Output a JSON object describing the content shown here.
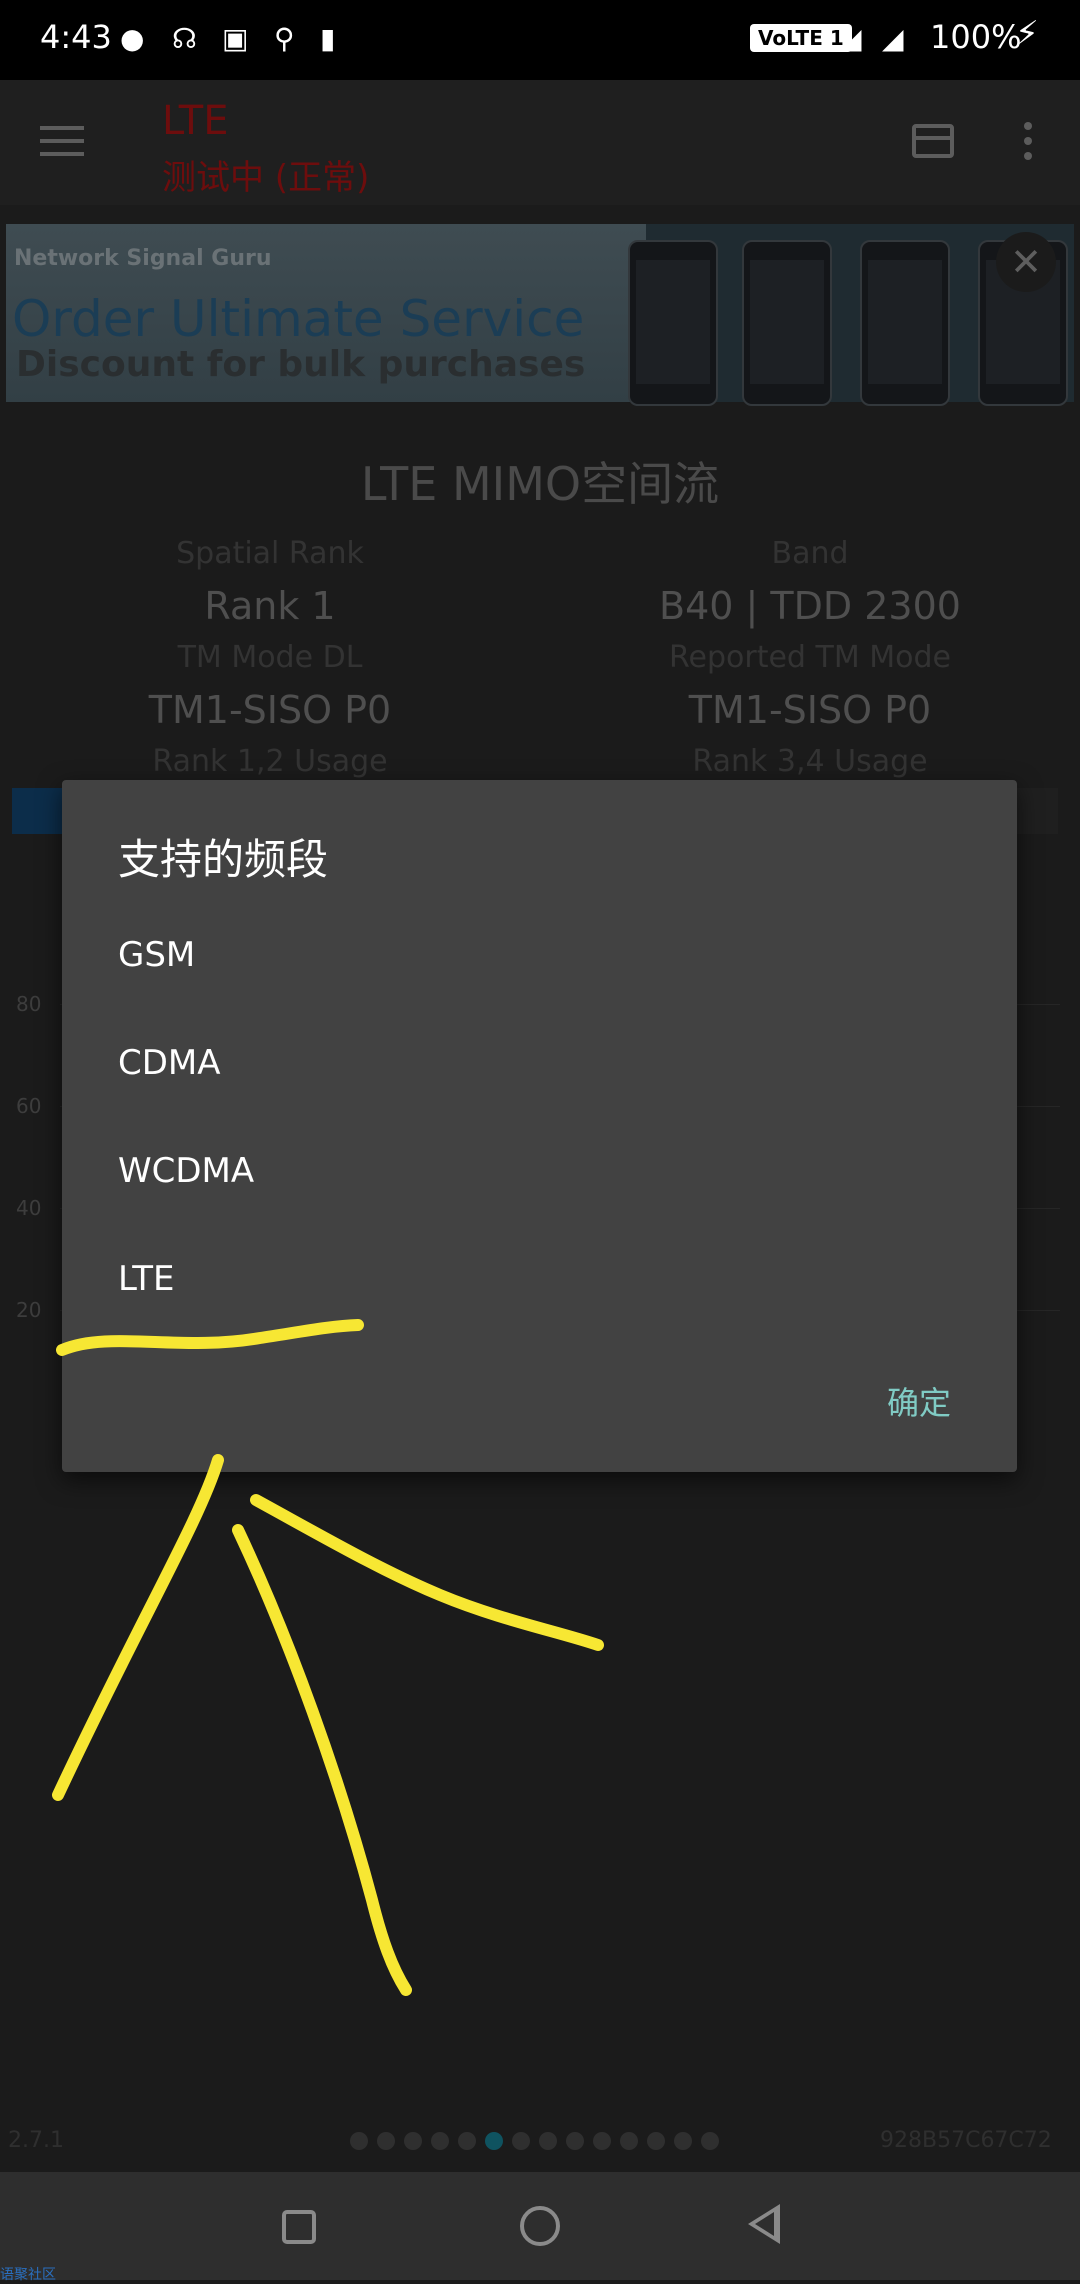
{
  "status_bar": {
    "time": "4:43",
    "volte": "VoLTE 1",
    "battery": "100%",
    "icons": [
      "flame-icon",
      "headphones-icon",
      "image-icon",
      "location-icon",
      "signal-icon",
      "network-4g-icon",
      "battery-charging-icon"
    ]
  },
  "app_bar": {
    "title": "LTE",
    "subtitle": "测试中 (正常)",
    "title_color": "#6d0d0d"
  },
  "ad": {
    "brand": "Network Signal Guru",
    "headline": "Order Ultimate Service",
    "subline": "Discount for bulk purchases"
  },
  "content": {
    "title": "LTE MIMO空间流",
    "stats": [
      {
        "label": "Spatial Rank",
        "value": "Rank 1"
      },
      {
        "label": "Band",
        "value": "B40 | TDD 2300"
      },
      {
        "label": "TM Mode DL",
        "value": "TM1-SISO P0"
      },
      {
        "label": "Reported TM Mode",
        "value": "TM1-SISO P0"
      }
    ],
    "usage_labels": [
      "Rank 1,2 Usage",
      "Rank 3,4 Usage"
    ],
    "y_axis": [
      "80",
      "60",
      "40",
      "20"
    ],
    "version": "2.7.1",
    "device_id": "928B57C67C72",
    "page_count": 14,
    "active_page": 5
  },
  "dialog": {
    "title": "支持的频段",
    "items": [
      "GSM",
      "CDMA",
      "WCDMA",
      "LTE"
    ],
    "ok_label": "确定",
    "accent": "#80cbc4"
  },
  "watermark": "语聚社区",
  "annotation_color": "#f7e733"
}
